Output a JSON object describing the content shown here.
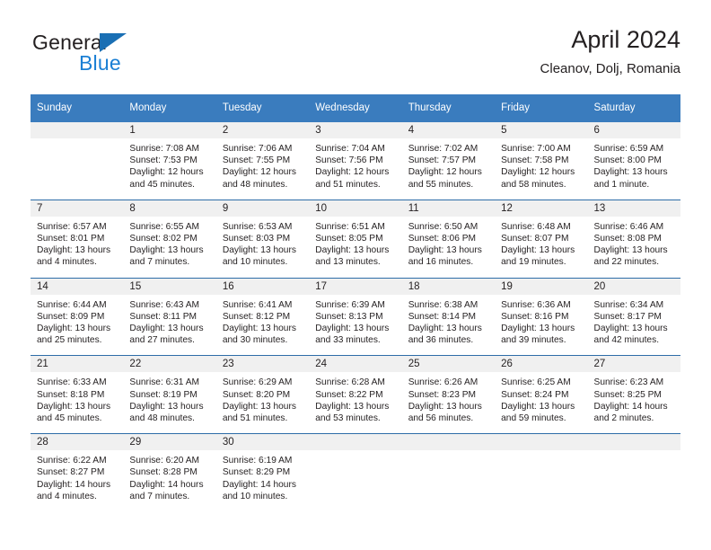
{
  "brand": {
    "name_part1": "General",
    "name_part2": "Blue",
    "triangle_icon": "blue-triangle-logo-mark",
    "color_dark": "#231f20",
    "color_blue": "#1a7fd4"
  },
  "header": {
    "title": "April 2024",
    "subtitle": "Cleanov, Dolj, Romania"
  },
  "calendar": {
    "header_bg": "#3a7cbe",
    "header_text_color": "#ffffff",
    "daynum_band_bg": "#f0f0f0",
    "row_divider_color": "#2e6da8",
    "weekdays": [
      "Sunday",
      "Monday",
      "Tuesday",
      "Wednesday",
      "Thursday",
      "Friday",
      "Saturday"
    ],
    "weeks": [
      [
        {
          "day": "",
          "lines": []
        },
        {
          "day": "1",
          "lines": [
            "Sunrise: 7:08 AM",
            "Sunset: 7:53 PM",
            "Daylight: 12 hours",
            "and 45 minutes."
          ]
        },
        {
          "day": "2",
          "lines": [
            "Sunrise: 7:06 AM",
            "Sunset: 7:55 PM",
            "Daylight: 12 hours",
            "and 48 minutes."
          ]
        },
        {
          "day": "3",
          "lines": [
            "Sunrise: 7:04 AM",
            "Sunset: 7:56 PM",
            "Daylight: 12 hours",
            "and 51 minutes."
          ]
        },
        {
          "day": "4",
          "lines": [
            "Sunrise: 7:02 AM",
            "Sunset: 7:57 PM",
            "Daylight: 12 hours",
            "and 55 minutes."
          ]
        },
        {
          "day": "5",
          "lines": [
            "Sunrise: 7:00 AM",
            "Sunset: 7:58 PM",
            "Daylight: 12 hours",
            "and 58 minutes."
          ]
        },
        {
          "day": "6",
          "lines": [
            "Sunrise: 6:59 AM",
            "Sunset: 8:00 PM",
            "Daylight: 13 hours",
            "and 1 minute."
          ]
        }
      ],
      [
        {
          "day": "7",
          "lines": [
            "Sunrise: 6:57 AM",
            "Sunset: 8:01 PM",
            "Daylight: 13 hours",
            "and 4 minutes."
          ]
        },
        {
          "day": "8",
          "lines": [
            "Sunrise: 6:55 AM",
            "Sunset: 8:02 PM",
            "Daylight: 13 hours",
            "and 7 minutes."
          ]
        },
        {
          "day": "9",
          "lines": [
            "Sunrise: 6:53 AM",
            "Sunset: 8:03 PM",
            "Daylight: 13 hours",
            "and 10 minutes."
          ]
        },
        {
          "day": "10",
          "lines": [
            "Sunrise: 6:51 AM",
            "Sunset: 8:05 PM",
            "Daylight: 13 hours",
            "and 13 minutes."
          ]
        },
        {
          "day": "11",
          "lines": [
            "Sunrise: 6:50 AM",
            "Sunset: 8:06 PM",
            "Daylight: 13 hours",
            "and 16 minutes."
          ]
        },
        {
          "day": "12",
          "lines": [
            "Sunrise: 6:48 AM",
            "Sunset: 8:07 PM",
            "Daylight: 13 hours",
            "and 19 minutes."
          ]
        },
        {
          "day": "13",
          "lines": [
            "Sunrise: 6:46 AM",
            "Sunset: 8:08 PM",
            "Daylight: 13 hours",
            "and 22 minutes."
          ]
        }
      ],
      [
        {
          "day": "14",
          "lines": [
            "Sunrise: 6:44 AM",
            "Sunset: 8:09 PM",
            "Daylight: 13 hours",
            "and 25 minutes."
          ]
        },
        {
          "day": "15",
          "lines": [
            "Sunrise: 6:43 AM",
            "Sunset: 8:11 PM",
            "Daylight: 13 hours",
            "and 27 minutes."
          ]
        },
        {
          "day": "16",
          "lines": [
            "Sunrise: 6:41 AM",
            "Sunset: 8:12 PM",
            "Daylight: 13 hours",
            "and 30 minutes."
          ]
        },
        {
          "day": "17",
          "lines": [
            "Sunrise: 6:39 AM",
            "Sunset: 8:13 PM",
            "Daylight: 13 hours",
            "and 33 minutes."
          ]
        },
        {
          "day": "18",
          "lines": [
            "Sunrise: 6:38 AM",
            "Sunset: 8:14 PM",
            "Daylight: 13 hours",
            "and 36 minutes."
          ]
        },
        {
          "day": "19",
          "lines": [
            "Sunrise: 6:36 AM",
            "Sunset: 8:16 PM",
            "Daylight: 13 hours",
            "and 39 minutes."
          ]
        },
        {
          "day": "20",
          "lines": [
            "Sunrise: 6:34 AM",
            "Sunset: 8:17 PM",
            "Daylight: 13 hours",
            "and 42 minutes."
          ]
        }
      ],
      [
        {
          "day": "21",
          "lines": [
            "Sunrise: 6:33 AM",
            "Sunset: 8:18 PM",
            "Daylight: 13 hours",
            "and 45 minutes."
          ]
        },
        {
          "day": "22",
          "lines": [
            "Sunrise: 6:31 AM",
            "Sunset: 8:19 PM",
            "Daylight: 13 hours",
            "and 48 minutes."
          ]
        },
        {
          "day": "23",
          "lines": [
            "Sunrise: 6:29 AM",
            "Sunset: 8:20 PM",
            "Daylight: 13 hours",
            "and 51 minutes."
          ]
        },
        {
          "day": "24",
          "lines": [
            "Sunrise: 6:28 AM",
            "Sunset: 8:22 PM",
            "Daylight: 13 hours",
            "and 53 minutes."
          ]
        },
        {
          "day": "25",
          "lines": [
            "Sunrise: 6:26 AM",
            "Sunset: 8:23 PM",
            "Daylight: 13 hours",
            "and 56 minutes."
          ]
        },
        {
          "day": "26",
          "lines": [
            "Sunrise: 6:25 AM",
            "Sunset: 8:24 PM",
            "Daylight: 13 hours",
            "and 59 minutes."
          ]
        },
        {
          "day": "27",
          "lines": [
            "Sunrise: 6:23 AM",
            "Sunset: 8:25 PM",
            "Daylight: 14 hours",
            "and 2 minutes."
          ]
        }
      ],
      [
        {
          "day": "28",
          "lines": [
            "Sunrise: 6:22 AM",
            "Sunset: 8:27 PM",
            "Daylight: 14 hours",
            "and 4 minutes."
          ]
        },
        {
          "day": "29",
          "lines": [
            "Sunrise: 6:20 AM",
            "Sunset: 8:28 PM",
            "Daylight: 14 hours",
            "and 7 minutes."
          ]
        },
        {
          "day": "30",
          "lines": [
            "Sunrise: 6:19 AM",
            "Sunset: 8:29 PM",
            "Daylight: 14 hours",
            "and 10 minutes."
          ]
        },
        {
          "day": "",
          "lines": []
        },
        {
          "day": "",
          "lines": []
        },
        {
          "day": "",
          "lines": []
        },
        {
          "day": "",
          "lines": []
        }
      ]
    ]
  }
}
